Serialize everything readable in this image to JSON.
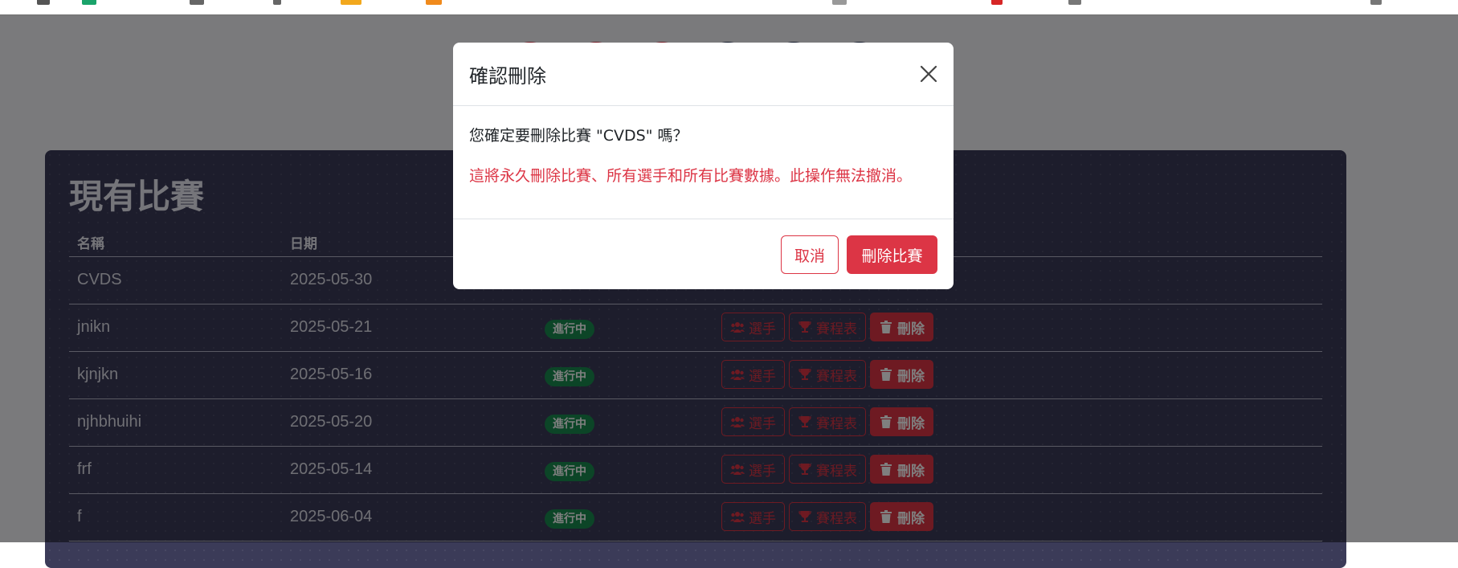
{
  "modal": {
    "title": "確認刪除",
    "confirm_text": "您確定要刪除比賽 \"CVDS\" 嗎？",
    "warning_text": "這將永久刪除比賽、所有選手和所有比賽數據。此操作無法撤消。",
    "cancel_label": "取消",
    "delete_label": "刪除比賽"
  },
  "panel": {
    "title": "現有比賽",
    "headers": [
      "名稱",
      "日期"
    ]
  },
  "rows": [
    {
      "name": "CVDS",
      "date": "2025-05-30",
      "status": "",
      "players": "",
      "bracket": "",
      "delete": ""
    },
    {
      "name": "jnikn",
      "date": "2025-05-21",
      "status": "進行中",
      "players": "選手",
      "bracket": "賽程表",
      "delete": "刪除"
    },
    {
      "name": "kjnjkn",
      "date": "2025-05-16",
      "status": "進行中",
      "players": "選手",
      "bracket": "賽程表",
      "delete": "刪除"
    },
    {
      "name": "njhbhuihi",
      "date": "2025-05-20",
      "status": "進行中",
      "players": "選手",
      "bracket": "賽程表",
      "delete": "刪除"
    },
    {
      "name": "frf",
      "date": "2025-05-14",
      "status": "進行中",
      "players": "選手",
      "bracket": "賽程表",
      "delete": "刪除"
    },
    {
      "name": "f",
      "date": "2025-06-04",
      "status": "進行中",
      "players": "選手",
      "bracket": "賽程表",
      "delete": "刪除"
    }
  ],
  "colors": {
    "danger": "#dc3545",
    "success": "#198a4f",
    "panel_bg": "#3b3b58",
    "overlay": "rgba(0,0,0,0.5)"
  },
  "icons": {
    "close": "close-icon",
    "players": "users-icon",
    "bracket": "trophy-icon",
    "delete": "trash-icon"
  }
}
